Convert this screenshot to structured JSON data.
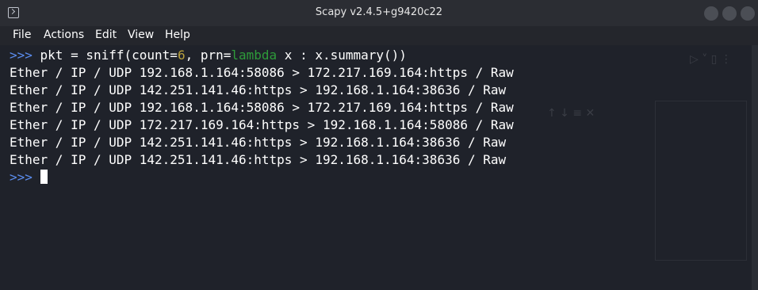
{
  "window": {
    "title": "Scapy v2.4.5+g9420c22"
  },
  "menu": {
    "items": [
      "File",
      "Actions",
      "Edit",
      "View",
      "Help"
    ]
  },
  "terminal": {
    "prompt": ">>>",
    "command_pre": " pkt = sniff(count=",
    "command_num": "6",
    "command_mid": ", prn=",
    "command_kw": "lambda",
    "command_post": " x : x.summary())",
    "output": [
      "Ether / IP / UDP 192.168.1.164:58086 > 172.217.169.164:https / Raw",
      "Ether / IP / UDP 142.251.141.46:https > 192.168.1.164:38636 / Raw",
      "Ether / IP / UDP 192.168.1.164:58086 > 172.217.169.164:https / Raw",
      "Ether / IP / UDP 172.217.169.164:https > 192.168.1.164:58086 / Raw",
      "Ether / IP / UDP 142.251.141.46:https > 192.168.1.164:38636 / Raw",
      "Ether / IP / UDP 142.251.141.46:https > 192.168.1.164:38636 / Raw"
    ]
  },
  "colors": {
    "prompt": "#5b8def",
    "number": "#b8a03d",
    "keyword": "#2e9b3a",
    "background": "#1f222a"
  }
}
